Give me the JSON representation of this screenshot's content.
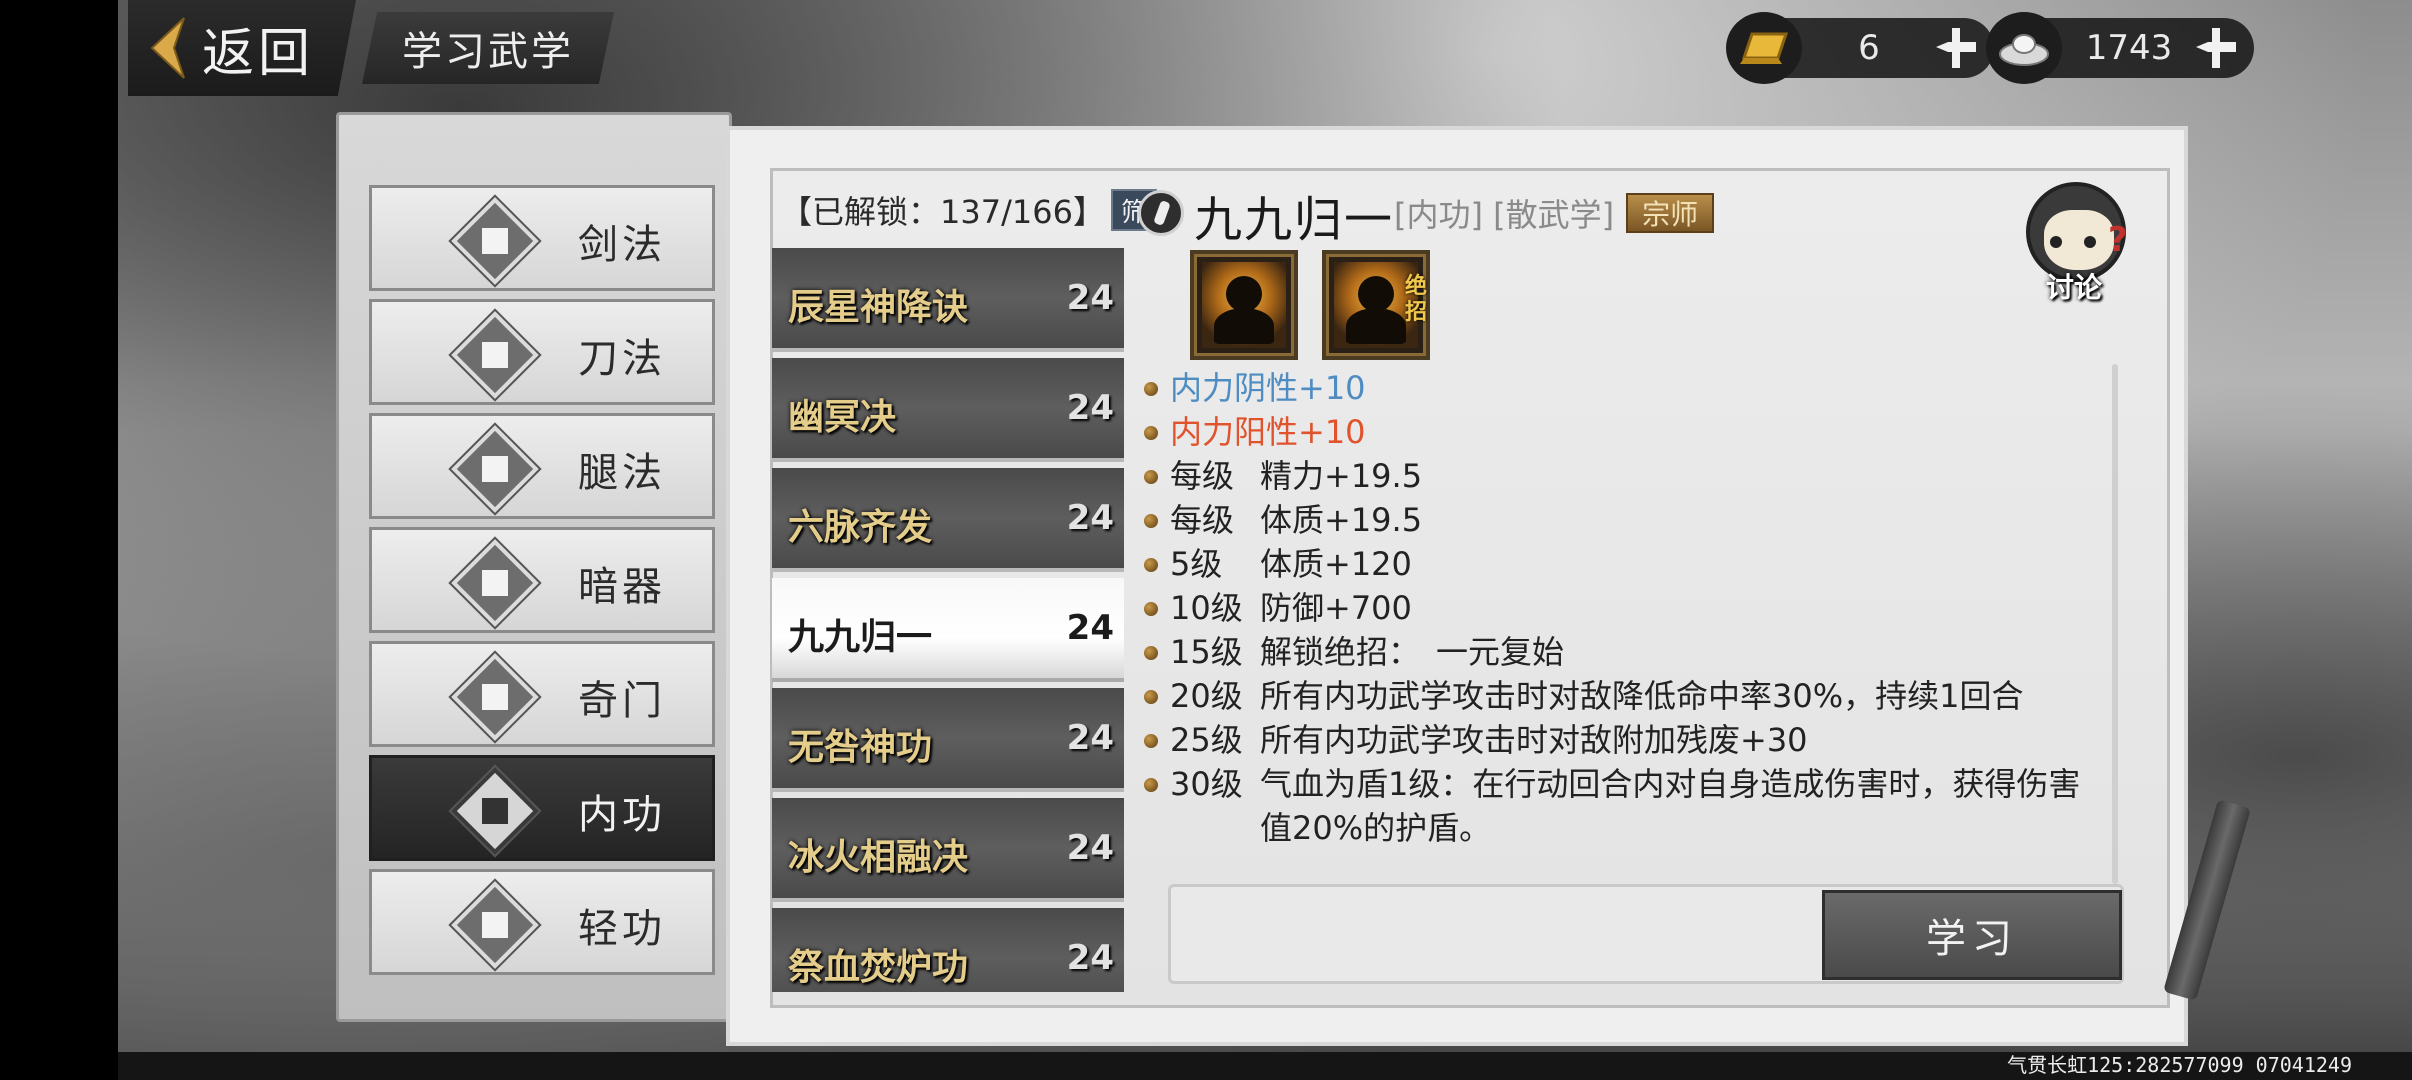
{
  "header": {
    "back_label": "返回",
    "page_title": "学习武学"
  },
  "currency": {
    "gold": "6",
    "silver": "1743"
  },
  "categories": [
    {
      "label": "剑法",
      "active": false
    },
    {
      "label": "刀法",
      "active": false
    },
    {
      "label": "腿法",
      "active": false
    },
    {
      "label": "暗器",
      "active": false
    },
    {
      "label": "奇门",
      "active": false
    },
    {
      "label": "内功",
      "active": true
    },
    {
      "label": "轻功",
      "active": false
    }
  ],
  "skill_list": {
    "unlock_text": "【已解锁：137/166】",
    "filter_label": "筛",
    "items": [
      {
        "name": "辰星神降诀",
        "level": "24"
      },
      {
        "name": "幽冥决",
        "level": "24"
      },
      {
        "name": "六脉齐发",
        "level": "24"
      },
      {
        "name": "九九归一",
        "level": "24"
      },
      {
        "name": "无咎神功",
        "level": "24"
      },
      {
        "name": "冰火相融决",
        "level": "24"
      },
      {
        "name": "祭血焚炉功",
        "level": "24"
      }
    ],
    "selected_index": 3
  },
  "detail": {
    "title": "九九归一",
    "tags": "[内功] [散武学]",
    "rank": "宗师",
    "discuss_label": "讨论",
    "ult_tag": "绝招",
    "effects": [
      {
        "level": "",
        "text": "内力阴性+10",
        "style": "yin"
      },
      {
        "level": "",
        "text": "内力阳性+10",
        "style": "yang"
      },
      {
        "level": "每级",
        "text": "精力+19.5",
        "style": ""
      },
      {
        "level": "每级",
        "text": "体质+19.5",
        "style": ""
      },
      {
        "level": "5级",
        "text": "体质+120",
        "style": ""
      },
      {
        "level": "10级",
        "text": "防御+700",
        "style": ""
      },
      {
        "level": "15级",
        "text": "解锁绝招：　一元复始",
        "style": ""
      },
      {
        "level": "20级",
        "text": "所有内功武学攻击时对敌降低命中率30%，持续1回合",
        "style": ""
      },
      {
        "level": "25级",
        "text": "所有内功武学攻击时对敌附加残废+30",
        "style": ""
      },
      {
        "level": "30级",
        "text": "气血为盾1级：在行动回合内对自身造成伤害时，获得伤害值20%的护盾。",
        "style": "wrap"
      }
    ],
    "learn_label": "学习"
  },
  "footer": {
    "player_id": "气贯长虹125:282577099  07041249"
  },
  "colors": {
    "yin": "#4e8cc2",
    "yang": "#e0532c",
    "list_name": "#e4cd8a",
    "rank_badge": "#9b7436"
  }
}
